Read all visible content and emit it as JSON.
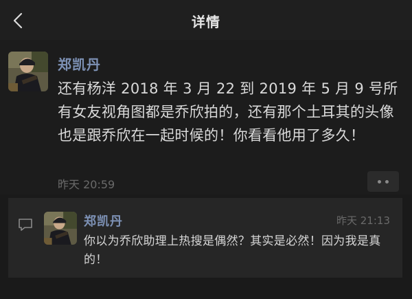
{
  "header": {
    "title": "详情",
    "back_icon": "chevron-left-icon"
  },
  "post": {
    "author": "郑凯丹",
    "content": "还有杨洋 2018 年 3 月 22 到 2019 年 5 月 9 号所有女友视角图都是乔欣拍的，还有那个土耳其的头像也是跟乔欣在一起时候的！你看看他用了多久！",
    "time": "昨天 20:59",
    "more_icon": "more-dots-icon"
  },
  "comment": {
    "icon": "comment-icon",
    "author": "郑凯丹",
    "time": "昨天 21:13",
    "content": "你以为乔欣助理上热搜是偶然？其实是必然！因为我是真的！"
  },
  "colors": {
    "background": "#1a1a1a",
    "name_link": "#7d91b5",
    "comment_panel": "#262626"
  }
}
